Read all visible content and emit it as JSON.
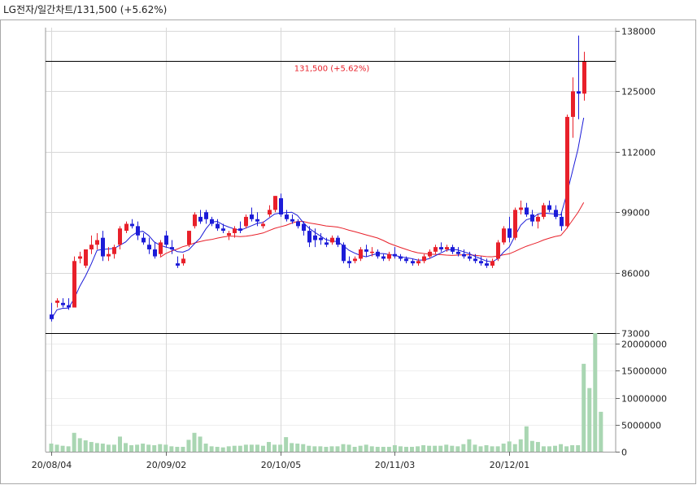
{
  "header": {
    "title": "LG전자/일간차트/131,500  (+5.62%)"
  },
  "colors": {
    "up": "#e8202a",
    "down": "#1c1cd8",
    "ma5": "#1c1cd8",
    "ma20": "#e8202a",
    "volume": "#a9d6b2",
    "grid": "#d8d8d8",
    "last_price_line": "#000000",
    "last_price_label": "#e8202a"
  },
  "chart_data": [
    {
      "type": "candlestick",
      "title": "LG전자/일간차트/131,500  (+5.62%)",
      "ylim": [
        73000,
        138000
      ],
      "yticks": [
        138000,
        125000,
        112000,
        99000,
        86000,
        73000
      ],
      "ytick_labels": [
        "138000",
        "125000",
        "112000",
        "99000",
        "86000",
        "73000"
      ],
      "xtick_labels": [
        {
          "label": "20/08/04",
          "index": 0
        },
        {
          "label": "20/09/02",
          "index": 20
        },
        {
          "label": "20/10/05",
          "index": 40
        },
        {
          "label": "20/11/03",
          "index": 60
        },
        {
          "label": "20/12/01",
          "index": 80
        }
      ],
      "last_price_annotation": {
        "label": "131,500 (+5.62%)",
        "value": 131500
      },
      "ohlc": [
        [
          77000,
          79500,
          75500,
          76000
        ],
        [
          79500,
          80500,
          78500,
          80000
        ],
        [
          79500,
          80500,
          78500,
          79000
        ],
        [
          79000,
          80500,
          78000,
          78500
        ],
        [
          78500,
          89500,
          78500,
          88500
        ],
        [
          89000,
          90500,
          88000,
          89500
        ],
        [
          87500,
          91000,
          87000,
          91000
        ],
        [
          91000,
          94000,
          90000,
          92000
        ],
        [
          92000,
          94500,
          91000,
          93000
        ],
        [
          93500,
          95000,
          88500,
          89500
        ],
        [
          89500,
          91500,
          88500,
          90000
        ],
        [
          90000,
          92000,
          89000,
          91500
        ],
        [
          92000,
          96000,
          91000,
          95500
        ],
        [
          95000,
          97000,
          94500,
          96500
        ],
        [
          96500,
          97500,
          95500,
          96000
        ],
        [
          96000,
          97000,
          93000,
          94000
        ],
        [
          93500,
          94500,
          92000,
          92500
        ],
        [
          92000,
          93500,
          90000,
          91000
        ],
        [
          91000,
          92500,
          89000,
          89500
        ],
        [
          90000,
          93000,
          89500,
          92500
        ],
        [
          94000,
          95000,
          91500,
          92000
        ],
        [
          91500,
          93000,
          90000,
          91000
        ],
        [
          88000,
          89500,
          87000,
          87500
        ],
        [
          88000,
          90000,
          87500,
          89000
        ],
        [
          92000,
          95000,
          91500,
          95000
        ],
        [
          96000,
          99000,
          95500,
          98500
        ],
        [
          98000,
          99500,
          96500,
          97000
        ],
        [
          99000,
          99500,
          96500,
          97500
        ],
        [
          97500,
          98000,
          96000,
          96500
        ],
        [
          96500,
          97500,
          95000,
          95500
        ],
        [
          95500,
          96500,
          94500,
          95000
        ],
        [
          94000,
          95000,
          93000,
          94500
        ],
        [
          94500,
          96000,
          93500,
          95500
        ],
        [
          95500,
          97000,
          94500,
          95000
        ],
        [
          96000,
          98500,
          95500,
          98000
        ],
        [
          98500,
          100000,
          97000,
          97500
        ],
        [
          97500,
          99000,
          96000,
          97000
        ],
        [
          96000,
          97000,
          95500,
          96500
        ],
        [
          98500,
          100500,
          98000,
          99500
        ],
        [
          99500,
          102500,
          99000,
          102500
        ],
        [
          102000,
          103000,
          98000,
          98500
        ],
        [
          98500,
          99500,
          97000,
          97500
        ],
        [
          97500,
          98500,
          96500,
          97000
        ],
        [
          97000,
          97500,
          95500,
          96000
        ],
        [
          96500,
          97000,
          94000,
          95000
        ],
        [
          95000,
          96000,
          91500,
          92500
        ],
        [
          94000,
          95500,
          91500,
          93000
        ],
        [
          93500,
          94500,
          92000,
          93000
        ],
        [
          92500,
          93500,
          91500,
          92000
        ],
        [
          92500,
          94000,
          92000,
          93500
        ],
        [
          93500,
          94000,
          91500,
          92000
        ],
        [
          92000,
          92500,
          88000,
          88500
        ],
        [
          88500,
          89500,
          87000,
          88000
        ],
        [
          88500,
          89500,
          88000,
          89000
        ],
        [
          89000,
          91500,
          88500,
          91000
        ],
        [
          91000,
          92000,
          89500,
          90500
        ],
        [
          90500,
          91500,
          89500,
          90500
        ],
        [
          90500,
          91000,
          89000,
          89500
        ],
        [
          89500,
          90000,
          88500,
          89000
        ],
        [
          89000,
          90500,
          88500,
          90000
        ],
        [
          90000,
          91500,
          89000,
          89500
        ],
        [
          89500,
          90000,
          88500,
          89000
        ],
        [
          89000,
          89500,
          88000,
          88500
        ],
        [
          88500,
          89000,
          87500,
          88000
        ],
        [
          88000,
          89000,
          87500,
          88500
        ],
        [
          88500,
          90000,
          88000,
          89500
        ],
        [
          89500,
          91000,
          89000,
          90500
        ],
        [
          90500,
          92000,
          90000,
          91500
        ],
        [
          91500,
          92500,
          90500,
          91000
        ],
        [
          91000,
          92000,
          90500,
          91500
        ],
        [
          91500,
          92000,
          90000,
          90500
        ],
        [
          90500,
          91500,
          89500,
          90000
        ],
        [
          90000,
          91000,
          89000,
          89500
        ],
        [
          89500,
          90500,
          88500,
          89000
        ],
        [
          89000,
          90000,
          88000,
          88500
        ],
        [
          88500,
          89500,
          87500,
          88000
        ],
        [
          88000,
          89000,
          87000,
          87500
        ],
        [
          87500,
          89000,
          87000,
          88500
        ],
        [
          89000,
          93000,
          88500,
          92500
        ],
        [
          92500,
          96000,
          92000,
          95500
        ],
        [
          95500,
          98000,
          92500,
          93500
        ],
        [
          93500,
          100000,
          93000,
          99500
        ],
        [
          99500,
          101500,
          98500,
          100000
        ],
        [
          100000,
          101000,
          98000,
          98500
        ],
        [
          98500,
          99500,
          96000,
          97000
        ],
        [
          97000,
          98500,
          95500,
          98000
        ],
        [
          98000,
          101000,
          97500,
          100500
        ],
        [
          100500,
          101500,
          99000,
          99500
        ],
        [
          99500,
          100500,
          97500,
          98000
        ],
        [
          98000,
          99000,
          95000,
          96000
        ],
        [
          96000,
          120000,
          95500,
          119500
        ],
        [
          119500,
          128000,
          115000,
          125000
        ],
        [
          125000,
          137000,
          119000,
          124500
        ],
        [
          124500,
          133500,
          123000,
          131500
        ]
      ],
      "volume": [
        1500000,
        1300000,
        1100000,
        1000000,
        3500000,
        2500000,
        2100000,
        1800000,
        1600000,
        1500000,
        1300000,
        1300000,
        2800000,
        1600000,
        1200000,
        1300000,
        1500000,
        1300000,
        1200000,
        1400000,
        1300000,
        1000000,
        900000,
        900000,
        2200000,
        3500000,
        2800000,
        1500000,
        1000000,
        900000,
        800000,
        1000000,
        1100000,
        1100000,
        1300000,
        1300000,
        1300000,
        1100000,
        1800000,
        1300000,
        1300000,
        2700000,
        1600000,
        1500000,
        1400000,
        1100000,
        1000000,
        1000000,
        900000,
        1000000,
        1000000,
        1400000,
        1300000,
        900000,
        1100000,
        1300000,
        1000000,
        900000,
        900000,
        900000,
        1200000,
        1000000,
        900000,
        900000,
        1000000,
        1200000,
        1100000,
        1100000,
        1100000,
        1300000,
        1100000,
        1000000,
        1400000,
        2300000,
        1300000,
        1000000,
        1200000,
        1000000,
        1000000,
        1500000,
        1900000,
        1400000,
        2300000,
        4700000,
        2000000,
        1800000,
        1000000,
        1000000,
        1100000,
        1400000,
        1000000,
        1200000,
        1200000,
        16300000,
        11800000,
        22000000,
        7400000
      ]
    },
    {
      "type": "bar",
      "ylim": [
        0,
        22000000
      ],
      "yticks": [
        0,
        5000000,
        10000000,
        15000000,
        20000000
      ],
      "ytick_labels": [
        "0",
        "5000000",
        "10000000",
        "15000000",
        "20000000"
      ]
    }
  ]
}
